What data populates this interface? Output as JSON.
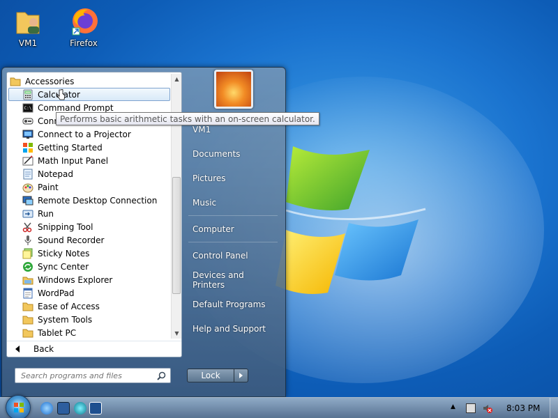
{
  "desktop": {
    "icons": [
      {
        "label": "VM1",
        "icon": "user-folder-icon"
      },
      {
        "label": "Firefox",
        "icon": "firefox-icon"
      }
    ]
  },
  "start_menu": {
    "folder_header": "Accessories",
    "programs": [
      {
        "label": "Calculator",
        "icon": "calculator-icon",
        "highlighted": true
      },
      {
        "label": "Command Prompt",
        "icon": "command-prompt-icon"
      },
      {
        "label": "Conn",
        "icon": "connect-icon"
      },
      {
        "label": "Connect to a Projector",
        "icon": "projector-icon"
      },
      {
        "label": "Getting Started",
        "icon": "getting-started-icon"
      },
      {
        "label": "Math Input Panel",
        "icon": "math-input-icon"
      },
      {
        "label": "Notepad",
        "icon": "notepad-icon"
      },
      {
        "label": "Paint",
        "icon": "paint-icon"
      },
      {
        "label": "Remote Desktop Connection",
        "icon": "remote-desktop-icon"
      },
      {
        "label": "Run",
        "icon": "run-icon"
      },
      {
        "label": "Snipping Tool",
        "icon": "snipping-tool-icon"
      },
      {
        "label": "Sound Recorder",
        "icon": "microphone-icon"
      },
      {
        "label": "Sticky Notes",
        "icon": "sticky-notes-icon"
      },
      {
        "label": "Sync Center",
        "icon": "sync-icon"
      },
      {
        "label": "Windows Explorer",
        "icon": "explorer-icon"
      },
      {
        "label": "WordPad",
        "icon": "wordpad-icon"
      },
      {
        "label": "Ease of Access",
        "icon": "folder-icon"
      },
      {
        "label": "System Tools",
        "icon": "folder-icon"
      },
      {
        "label": "Tablet PC",
        "icon": "folder-icon"
      }
    ],
    "back_label": "Back",
    "search_placeholder": "Search programs and files",
    "tooltip": "Performs basic arithmetic tasks with an on-screen calculator.",
    "right_pane": {
      "user": "VM1",
      "items": [
        "Documents",
        "Pictures",
        "Music",
        "Computer",
        "Control Panel",
        "Devices and Printers",
        "Default Programs",
        "Help and Support"
      ]
    },
    "lock_label": "Lock"
  },
  "taskbar": {
    "clock": "8:03 PM",
    "pinned": [
      "internet-explorer-icon",
      "monitor-icon",
      "media-icon",
      "remote-icon"
    ]
  },
  "colors": {
    "wallpaper": "#1a73cf",
    "highlight_border": "#7da2ce"
  }
}
